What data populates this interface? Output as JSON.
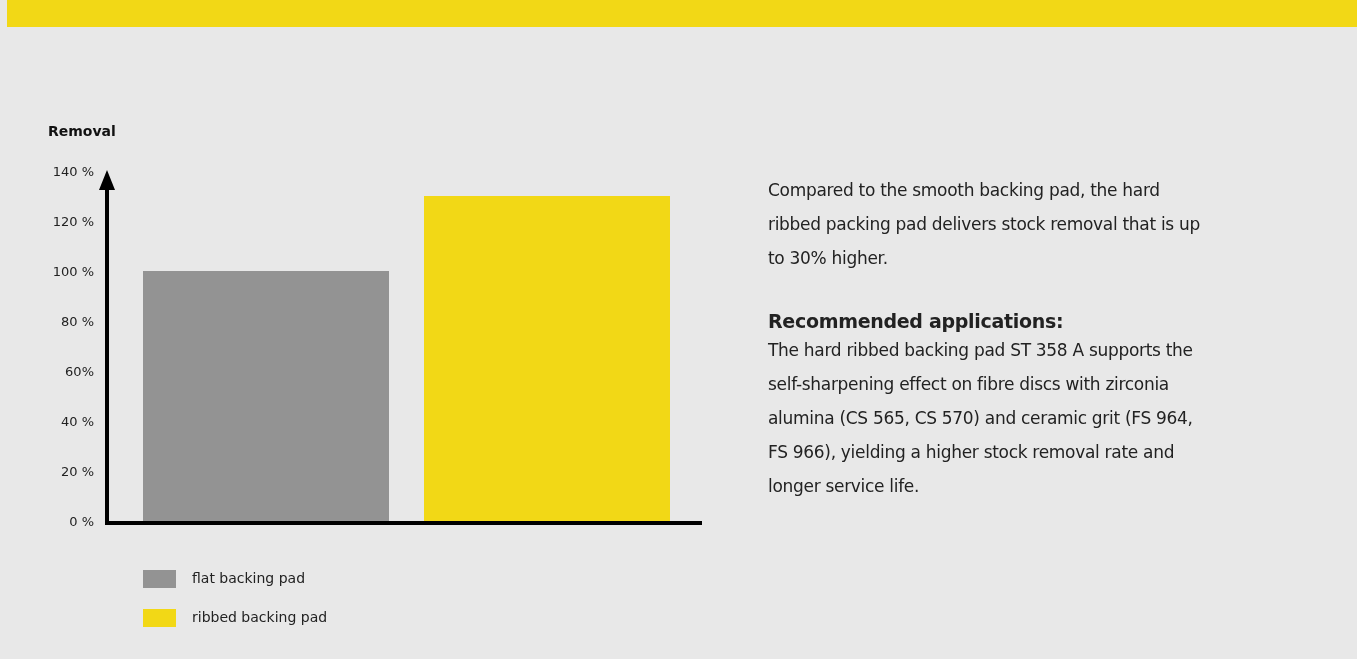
{
  "chart": {
    "chart_data": {
      "type": "bar",
      "ylabel": "Removal",
      "ylim": [
        0,
        140
      ],
      "yticks": [
        {
          "value": 0,
          "label": "0 %"
        },
        {
          "value": 20,
          "label": "20 %"
        },
        {
          "value": 40,
          "label": "40 %"
        },
        {
          "value": 60,
          "label": "60%"
        },
        {
          "value": 80,
          "label": "80 %"
        },
        {
          "value": 100,
          "label": "100 %"
        },
        {
          "value": 120,
          "label": "120 %"
        },
        {
          "value": 140,
          "label": "140 %"
        }
      ],
      "series": [
        {
          "name": "flat backing pad",
          "color": "#939393",
          "values": [
            100
          ]
        },
        {
          "name": "ribbed backing pad",
          "color": "#f2d816",
          "values": [
            130
          ]
        }
      ]
    }
  },
  "description": {
    "intro": "Compared to the smooth backing pad, the hard ribbed packing pad delivers stock removal that is up to 30% higher.",
    "heading": "Recommended applications:",
    "body": "The hard ribbed backing pad ST 358 A supports the self-sharpening effect on fibre discs with zirconia alumina (CS 565, CS 570) and ceramic grit (FS 964, FS 966), yielding a higher stock removal rate and longer service life."
  }
}
